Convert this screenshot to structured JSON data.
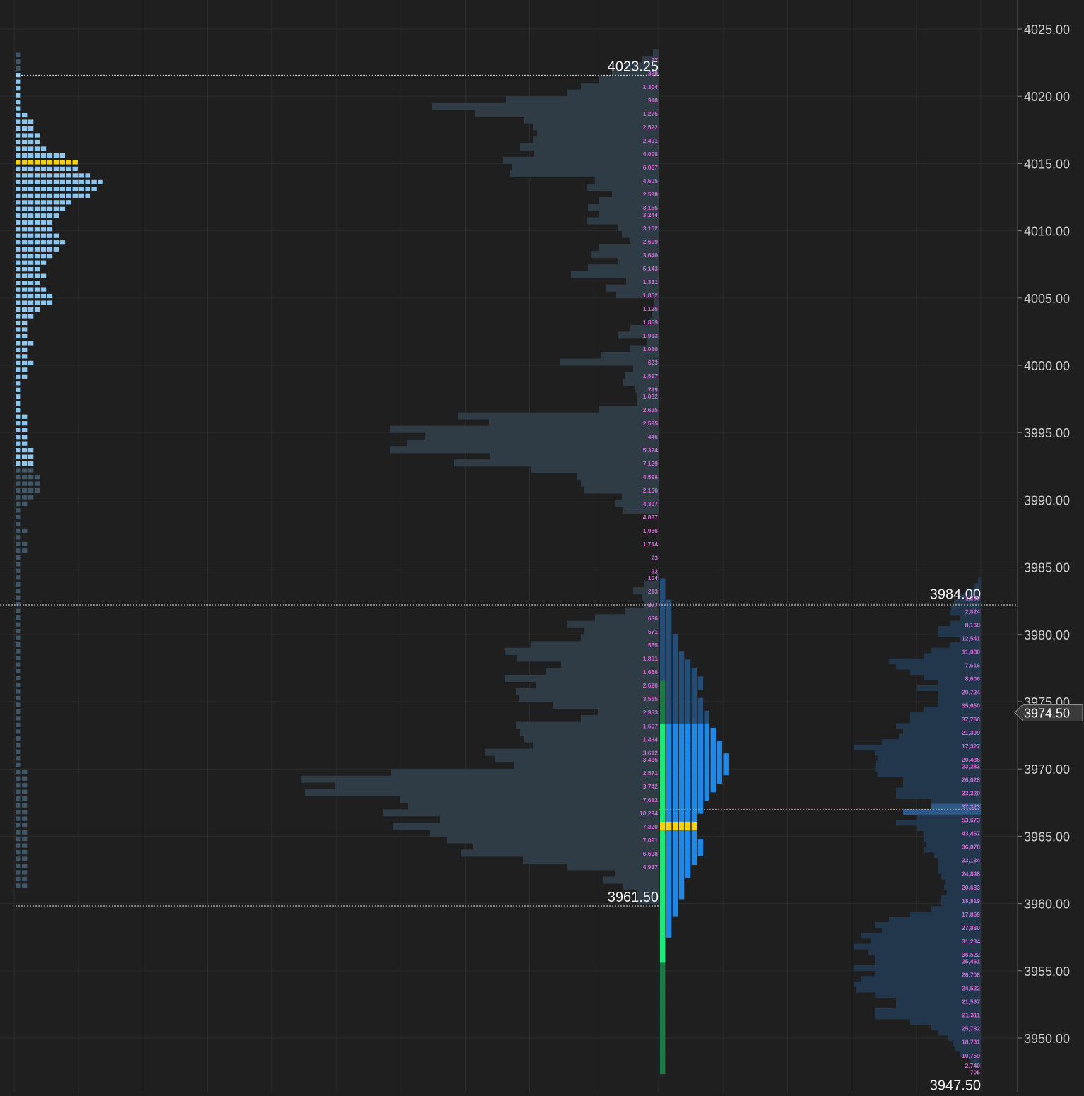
{
  "chart_data": {
    "type": "market-profile",
    "y_axis": {
      "ticks": [
        "4025.00",
        "4020.00",
        "4015.00",
        "4010.00",
        "4005.00",
        "4000.00",
        "3995.00",
        "3990.00",
        "3985.00",
        "3980.00",
        "3975.00",
        "3970.00",
        "3965.00",
        "3960.00",
        "3955.00",
        "3950.00"
      ],
      "range": [
        3946,
        4026.5
      ]
    },
    "current_price": {
      "label": "3974.50",
      "value": 3974.5
    },
    "prior_session": {
      "high": 4023.25,
      "low": 3961.5,
      "high_label": "4023.25",
      "low_label": "3961.50",
      "poc": 4015.5,
      "tpo_counts": [
        1,
        1,
        1,
        1,
        1,
        1,
        1,
        1,
        1,
        2,
        3,
        3,
        4,
        4,
        5,
        8,
        10,
        10,
        12,
        14,
        13,
        12,
        9,
        8,
        7,
        6,
        6,
        7,
        8,
        7,
        6,
        5,
        4,
        5,
        4,
        5,
        6,
        6,
        4,
        3,
        2,
        2,
        2,
        3,
        2,
        2,
        3,
        2,
        2,
        1,
        1,
        1,
        1,
        1,
        2,
        2,
        2,
        2,
        2,
        3,
        3,
        3,
        3,
        4,
        4,
        4,
        3,
        2,
        1,
        1,
        1,
        2,
        1,
        2,
        2,
        1,
        1,
        1,
        1,
        1,
        1,
        1,
        1,
        1,
        1,
        1,
        1,
        1,
        1,
        1,
        1,
        1,
        1,
        1,
        1,
        1,
        1,
        1,
        1,
        1,
        1,
        1,
        1,
        1,
        1,
        1,
        1,
        2,
        2,
        2,
        2,
        2,
        2,
        2,
        2,
        2,
        2,
        2,
        2,
        2,
        2,
        2,
        2,
        2,
        2
      ],
      "volume_labels": [
        {
          "price": 4023.0,
          "text": "97"
        },
        {
          "price": 4022.0,
          "text": "398"
        },
        {
          "price": 4021.0,
          "text": "1,304"
        },
        {
          "price": 4020.0,
          "text": "918"
        },
        {
          "price": 4019.0,
          "text": "1,275"
        },
        {
          "price": 4018.0,
          "text": "2,522"
        },
        {
          "price": 4017.0,
          "text": "2,491"
        },
        {
          "price": 4016.0,
          "text": "4,008"
        },
        {
          "price": 4015.0,
          "text": "6,057"
        },
        {
          "price": 4014.0,
          "text": "4,605"
        },
        {
          "price": 4013.0,
          "text": "2,598"
        },
        {
          "price": 4012.0,
          "text": "3,165"
        },
        {
          "price": 4011.5,
          "text": "3,244"
        },
        {
          "price": 4010.5,
          "text": "3,162"
        },
        {
          "price": 4009.5,
          "text": "2,609"
        },
        {
          "price": 4008.5,
          "text": "3,640"
        },
        {
          "price": 4007.5,
          "text": "5,143"
        },
        {
          "price": 4006.5,
          "text": "1,331"
        },
        {
          "price": 4005.5,
          "text": "1,852"
        },
        {
          "price": 4004.5,
          "text": "1,125"
        },
        {
          "price": 4003.5,
          "text": "1,859"
        },
        {
          "price": 4002.5,
          "text": "1,913"
        },
        {
          "price": 4001.5,
          "text": "1,010"
        },
        {
          "price": 4000.5,
          "text": "623"
        },
        {
          "price": 3999.5,
          "text": "1,597"
        },
        {
          "price": 3998.5,
          "text": "799"
        },
        {
          "price": 3998.0,
          "text": "1,032"
        },
        {
          "price": 3997.0,
          "text": "2,635"
        },
        {
          "price": 3996.0,
          "text": "2,595"
        },
        {
          "price": 3995.0,
          "text": "446"
        },
        {
          "price": 3994.0,
          "text": "5,324"
        },
        {
          "price": 3993.0,
          "text": "7,129"
        },
        {
          "price": 3992.0,
          "text": "4,598"
        },
        {
          "price": 3991.0,
          "text": "2,156"
        },
        {
          "price": 3990.0,
          "text": "4,307"
        },
        {
          "price": 3989.0,
          "text": "4,837"
        },
        {
          "price": 3988.0,
          "text": "1,936"
        },
        {
          "price": 3987.0,
          "text": "1,714"
        },
        {
          "price": 3986.0,
          "text": "23"
        },
        {
          "price": 3985.0,
          "text": "52"
        },
        {
          "price": 3984.5,
          "text": "104"
        },
        {
          "price": 3983.5,
          "text": "213"
        },
        {
          "price": 3982.5,
          "text": "377"
        },
        {
          "price": 3981.5,
          "text": "636"
        },
        {
          "price": 3980.5,
          "text": "571"
        },
        {
          "price": 3979.5,
          "text": "555"
        },
        {
          "price": 3978.5,
          "text": "1,891"
        },
        {
          "price": 3977.5,
          "text": "1,666"
        },
        {
          "price": 3976.5,
          "text": "2,620"
        },
        {
          "price": 3975.5,
          "text": "3,565"
        },
        {
          "price": 3974.5,
          "text": "2,933"
        },
        {
          "price": 3973.5,
          "text": "1,607"
        },
        {
          "price": 3972.5,
          "text": "1,434"
        },
        {
          "price": 3971.5,
          "text": "3,612"
        },
        {
          "price": 3971.0,
          "text": "3,435"
        },
        {
          "price": 3970.0,
          "text": "2,571"
        },
        {
          "price": 3969.0,
          "text": "3,742"
        },
        {
          "price": 3968.0,
          "text": "7,612"
        },
        {
          "price": 3967.0,
          "text": "10,294"
        },
        {
          "price": 3966.0,
          "text": "7,320"
        },
        {
          "price": 3965.0,
          "text": "7,091"
        },
        {
          "price": 3964.0,
          "text": "6,608"
        },
        {
          "price": 3963.0,
          "text": "4,937"
        }
      ],
      "volume_widths": [
        8,
        24,
        48,
        66,
        84,
        110,
        130,
        216,
        320,
        260,
        190,
        178,
        172,
        178,
        196,
        176,
        220,
        208,
        210,
        90,
        102,
        66,
        84,
        100,
        84,
        102,
        58,
        52,
        40,
        84,
        96,
        58,
        100,
        124,
        46,
        74,
        60,
        6,
        6,
        10,
        12,
        40,
        58,
        16,
        40,
        82,
        140,
        36,
        48,
        50,
        34,
        30,
        30,
        84,
        284,
        240,
        380,
        330,
        356,
        380,
        238,
        290,
        180,
        116,
        110,
        106,
        52,
        62,
        50,
        0,
        0,
        0,
        0,
        0,
        0,
        0,
        0,
        0,
        4,
        20,
        36,
        24,
        20,
        48,
        90,
        130,
        106,
        110,
        180,
        218,
        200,
        138,
        160,
        218,
        174,
        202,
        198,
        150,
        86,
        110,
        202,
        196,
        190,
        178,
        246,
        232,
        204,
        378,
        506,
        458,
        500,
        366,
        354,
        390,
        310,
        376,
        324,
        300,
        262,
        280,
        192,
        130,
        62,
        78,
        50,
        30,
        30
      ]
    },
    "current_session": {
      "high": 3984.0,
      "low": 3947.5,
      "high_label": "3984.00",
      "low_label": "3947.50",
      "poc": 3965.75,
      "value_area": [
        3955.75,
        3973.25
      ],
      "volume_poc": 3967.0,
      "volume_labels": [
        {
          "price": 3983.0,
          "text": "1,289"
        },
        {
          "price": 3982.0,
          "text": "2,824"
        },
        {
          "price": 3981.0,
          "text": "8,168"
        },
        {
          "price": 3980.0,
          "text": "12,541"
        },
        {
          "price": 3979.0,
          "text": "11,080"
        },
        {
          "price": 3978.0,
          "text": "7,616"
        },
        {
          "price": 3977.0,
          "text": "8,606"
        },
        {
          "price": 3976.0,
          "text": "20,724"
        },
        {
          "price": 3975.0,
          "text": "35,650"
        },
        {
          "price": 3974.0,
          "text": "37,760"
        },
        {
          "price": 3973.0,
          "text": "21,399"
        },
        {
          "price": 3972.0,
          "text": "17,327"
        },
        {
          "price": 3971.0,
          "text": "20,486"
        },
        {
          "price": 3970.5,
          "text": "23,283"
        },
        {
          "price": 3969.5,
          "text": "26,028"
        },
        {
          "price": 3968.5,
          "text": "33,320"
        },
        {
          "price": 3967.5,
          "text": "37,323"
        },
        {
          "price": 3966.5,
          "text": "53,673"
        },
        {
          "price": 3965.5,
          "text": "43,467"
        },
        {
          "price": 3964.5,
          "text": "36,078"
        },
        {
          "price": 3963.5,
          "text": "33,134"
        },
        {
          "price": 3962.5,
          "text": "24,848"
        },
        {
          "price": 3961.5,
          "text": "20,683"
        },
        {
          "price": 3960.5,
          "text": "18,819"
        },
        {
          "price": 3959.5,
          "text": "17,869"
        },
        {
          "price": 3958.5,
          "text": "27,880"
        },
        {
          "price": 3957.5,
          "text": "31,234"
        },
        {
          "price": 3956.5,
          "text": "36,522"
        },
        {
          "price": 3956.0,
          "text": "25,461"
        },
        {
          "price": 3955.0,
          "text": "26,708"
        },
        {
          "price": 3954.0,
          "text": "24,522"
        },
        {
          "price": 3953.0,
          "text": "21,597"
        },
        {
          "price": 3952.0,
          "text": "21,311"
        },
        {
          "price": 3951.0,
          "text": "25,782"
        },
        {
          "price": 3950.0,
          "text": "18,731"
        },
        {
          "price": 3949.0,
          "text": "10,759"
        },
        {
          "price": 3948.25,
          "text": "2,740"
        },
        {
          "price": 3947.75,
          "text": "705"
        }
      ],
      "volume_widths": [
        4,
        10,
        20,
        30,
        38,
        42,
        44,
        30,
        44,
        60,
        60,
        30,
        44,
        70,
        80,
        130,
        120,
        100,
        80,
        60,
        90,
        60,
        60,
        60,
        80,
        100,
        100,
        120,
        110,
        116,
        140,
        180,
        150,
        146,
        148,
        150,
        146,
        110,
        110,
        120,
        120,
        70,
        70,
        110,
        90,
        120,
        90,
        80,
        80,
        78,
        80,
        66,
        60,
        60,
        60,
        56,
        50,
        52,
        48,
        56,
        56,
        70,
        100,
        130,
        150,
        140,
        170,
        156,
        180,
        160,
        150,
        150,
        180,
        150,
        170,
        180,
        176,
        150,
        120,
        120,
        150,
        150,
        100,
        70,
        60,
        46,
        40,
        36,
        30,
        16,
        8
      ],
      "tpo_counts": [
        1,
        1,
        1,
        1,
        1,
        2,
        2,
        2,
        2,
        2,
        2,
        2,
        2,
        3,
        3,
        3,
        3,
        4,
        4,
        5,
        5,
        6,
        6,
        7,
        7,
        7,
        6,
        6,
        7,
        7,
        7,
        8,
        8,
        8,
        8,
        9,
        9,
        9,
        10,
        10,
        10,
        11,
        11,
        11,
        11,
        11,
        10,
        10,
        9,
        9,
        8,
        8,
        7,
        7,
        7,
        6,
        6,
        6,
        6,
        6,
        6,
        7,
        7,
        7,
        7,
        6,
        6,
        5,
        5,
        5,
        4,
        4,
        4,
        4,
        4,
        3,
        3,
        3,
        3,
        2,
        2,
        2,
        2,
        2,
        1,
        1,
        1,
        1,
        1,
        1,
        1,
        1,
        1,
        1,
        1,
        1,
        1,
        1,
        1,
        1,
        1,
        1,
        1,
        1,
        1,
        1,
        1,
        1,
        1,
        1,
        1,
        1,
        1,
        1,
        1,
        1
      ]
    },
    "colors": {
      "background": "#1f1f1f",
      "grid": "#2c2c2c",
      "tpo_prior_light": "#8dc7ef",
      "tpo_prior_dark": "#3f5766",
      "tpo_current_blue": "#1e88e8",
      "tpo_current_dark": "#244e7a",
      "tpo_green_bright": "#1de978",
      "tpo_green_dark": "#1c7a44",
      "poc": "#f5d400",
      "volume_prior": "#2f3c45",
      "volume_prior_poc": "#4f6a80",
      "volume_current": "#22364c",
      "volume_current_poc": "#2c5a88",
      "volume_label": "#d06bd6"
    }
  }
}
